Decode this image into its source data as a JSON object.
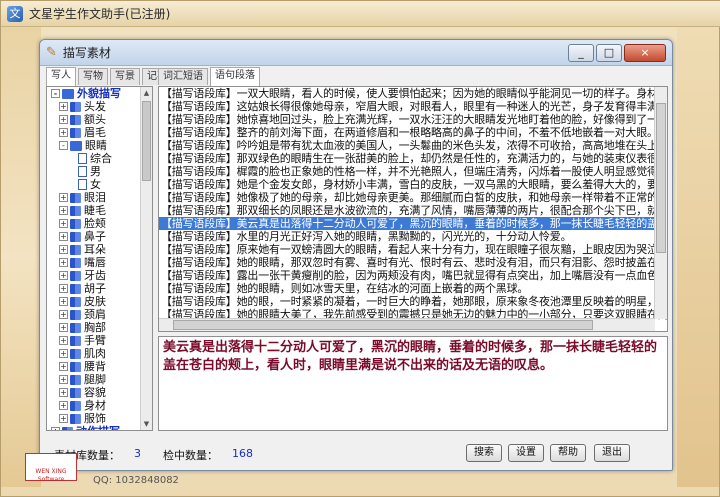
{
  "app": {
    "title": "文星学生作文助手(已注册)"
  },
  "dialog": {
    "title": "描写素材",
    "controls": {
      "minimize": "_",
      "maximize": "□",
      "close": "×"
    }
  },
  "left_tabs": [
    "写人",
    "写物",
    "写景",
    "记事"
  ],
  "right_tabs": [
    "词汇短语",
    "语句段落"
  ],
  "tree": [
    {
      "label": "外貌描写",
      "level": 0,
      "expander": "-",
      "icon": "book-open",
      "top": true
    },
    {
      "label": "头发",
      "level": 1,
      "expander": "+",
      "icon": "book"
    },
    {
      "label": "额头",
      "level": 1,
      "expander": "+",
      "icon": "book"
    },
    {
      "label": "眉毛",
      "level": 1,
      "expander": "+",
      "icon": "book"
    },
    {
      "label": "眼睛",
      "level": 1,
      "expander": "-",
      "icon": "book-open"
    },
    {
      "label": "综合",
      "level": 2,
      "expander": "",
      "icon": "page"
    },
    {
      "label": "男",
      "level": 2,
      "expander": "",
      "icon": "page"
    },
    {
      "label": "女",
      "level": 2,
      "expander": "",
      "icon": "page"
    },
    {
      "label": "眼泪",
      "level": 1,
      "expander": "+",
      "icon": "book"
    },
    {
      "label": "睫毛",
      "level": 1,
      "expander": "+",
      "icon": "book"
    },
    {
      "label": "脸颊",
      "level": 1,
      "expander": "+",
      "icon": "book"
    },
    {
      "label": "鼻子",
      "level": 1,
      "expander": "+",
      "icon": "book"
    },
    {
      "label": "耳朵",
      "level": 1,
      "expander": "+",
      "icon": "book"
    },
    {
      "label": "嘴唇",
      "level": 1,
      "expander": "+",
      "icon": "book"
    },
    {
      "label": "牙齿",
      "level": 1,
      "expander": "+",
      "icon": "book"
    },
    {
      "label": "胡子",
      "level": 1,
      "expander": "+",
      "icon": "book"
    },
    {
      "label": "皮肤",
      "level": 1,
      "expander": "+",
      "icon": "book"
    },
    {
      "label": "颈肩",
      "level": 1,
      "expander": "+",
      "icon": "book"
    },
    {
      "label": "胸部",
      "level": 1,
      "expander": "+",
      "icon": "book"
    },
    {
      "label": "手臂",
      "level": 1,
      "expander": "+",
      "icon": "book"
    },
    {
      "label": "肌肉",
      "level": 1,
      "expander": "+",
      "icon": "book"
    },
    {
      "label": "腰背",
      "level": 1,
      "expander": "+",
      "icon": "book"
    },
    {
      "label": "腿脚",
      "level": 1,
      "expander": "+",
      "icon": "book"
    },
    {
      "label": "容貌",
      "level": 1,
      "expander": "+",
      "icon": "book"
    },
    {
      "label": "身材",
      "level": 1,
      "expander": "+",
      "icon": "book"
    },
    {
      "label": "服饰",
      "level": 1,
      "expander": "+",
      "icon": "book"
    },
    {
      "label": "动作描写",
      "level": 0,
      "expander": "+",
      "icon": "book",
      "top": true
    }
  ],
  "list": [
    "【描写语段库】一双大眼睛，看人的时候，使人要惧怕起来；因为她的眼睛似乎能洞见一切的样子。身材不",
    "【描写语段库】这姑娘长得很像她母亲，窄眉大眼，对眼看人，眼里有一种迷人的光芒，身子发育得丰满，",
    "【描写语段库】她惊喜地回过头，脸上充满光辉，一双水汪汪的大眼睛发光地盯着他的脸，好像得到了一个",
    "【描写语段库】整齐的前刘海下面，在两道修眉和一根略略高的鼻子的中间，不羞不低地嵌着一对大眼。这",
    "【描写语段库】吟吟姐是带有犹太血液的美国人，一头鬈曲的米色头发，浓得不可收拾，高高地堆在头上；",
    "【描写语段库】那双绿色的眼睛生在一张甜美的脸上，却仍然是任性的，充满活力的，与她的装束仪表很不",
    "【描写语段库】樨霞的脸也正象她的性格一样，并不光艳照人，但端庄清秀，闪烁着一股使人明显感觉得到",
    "【描写语段库】她是个金发女郎，身材娇小丰满，雪白的皮肤，一双乌黑的大眼睛，要么羞得大大的，要么",
    "【描写语段库】她像极了她的母亲，却比她母亲更美。那细腻而白皙的皮肤，和她母亲一样带着不正常的苍",
    "【描写语段库】那双细长的凤眼还是水波欲流的，充满了风情，嘴唇薄薄的两片，很配合那个尖下巴，就是",
    "【描写语段库】美云真是出落得十二分动人可爱了，黑沉的眼睛，垂着的时候多，那一抹长睫毛轻轻的盖在",
    "【描写语段库】水里的月光正好泻入她的眼睛，黑黝黝的，闪光光的，十分动人怜爱。",
    "【描写语段库】原来她有一双螃清圆大的眼睛，看起人来十分有力，现在眼瞳子很灰黯，上眼皮因为哭泣太",
    "【描写语段库】她的眼睛，那双忽时有雾、喜时有光、恨时有云、悲时没有泪，而只有泪影、怨时披盖在黑",
    "【描写语段库】露出一张干黄瘦削的脸，因为两颊没有肉，嘴巴就显得有点突出，加上嘴唇没有一点血色，",
    "【描写语段库】她的眼睛，则如冰雪天里，在结冰的河面上嵌着的两个黑球。",
    "【描写语段库】她的眼，一时紧紧的凝着，一时巨大的睁着，她那眼，原来象冬夜池潭里反映着的明星，现",
    "【描写语段库】她的眼睛大美了，我先前感受到的震撼只是她无边的魅力中的一小部分，只要这双眼睛在闪",
    "【描写语段库】她们的眉目中有一种与众不同的风致，眉毛长得很密，眼睛很大很亮。"
  ],
  "selected_index": 10,
  "detail_text": "美云真是出落得十二分动人可爱了，黑沉的眼睛，垂着的时候多，那一抹长睫毛轻轻的盖在苍白的颊上，看人时，眼睛里满是说不出来的话及无语的叹息。",
  "status": {
    "library_label": "素材库数量：",
    "library_count": "3",
    "search_label": "检中数量：",
    "search_count": "168"
  },
  "buttons": {
    "search": "搜索",
    "settings": "设置",
    "help": "帮助",
    "exit": "退出"
  },
  "footer": {
    "logo_text": "WEN XING Software",
    "qq": "QQ: 1032848082"
  },
  "colors": {
    "selection": "#3d7ad6",
    "detail_text": "#7a0a2a",
    "tree_top": "#1530c0",
    "count": "#1730c0"
  }
}
